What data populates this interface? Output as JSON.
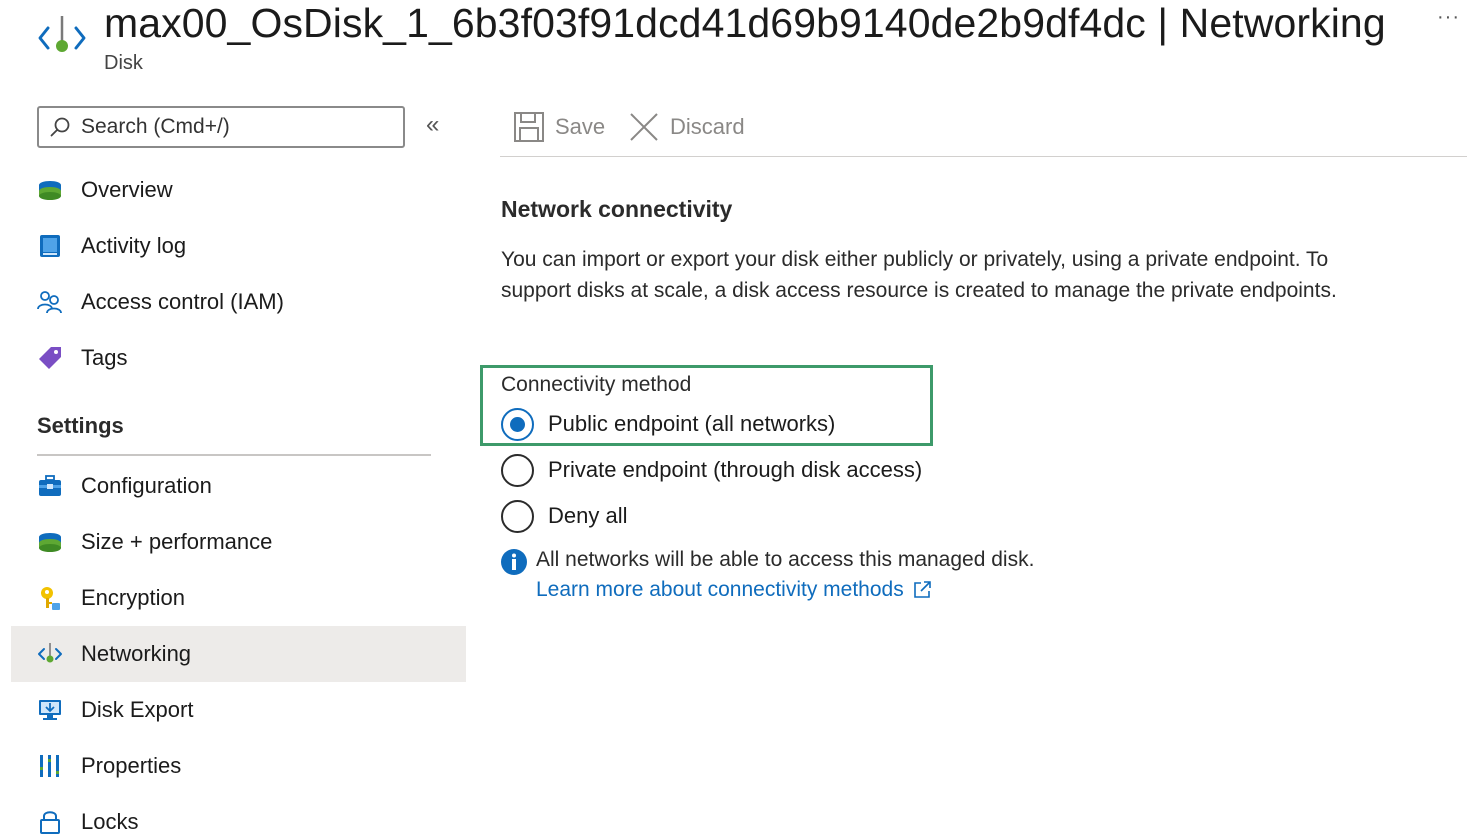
{
  "header": {
    "title": "max00_OsDisk_1_6b3f03f91dcd41d69b9140de2b9df4dc | Networking",
    "subtitle": "Disk",
    "more": "···"
  },
  "search": {
    "placeholder": "Search (Cmd+/)",
    "collapse": "«"
  },
  "sidebar": {
    "items": [
      {
        "label": "Overview",
        "icon": "overview-disk-icon"
      },
      {
        "label": "Activity log",
        "icon": "activity-log-icon"
      },
      {
        "label": "Access control (IAM)",
        "icon": "people-icon"
      },
      {
        "label": "Tags",
        "icon": "tag-icon"
      }
    ],
    "settings_header": "Settings",
    "settings_items": [
      {
        "label": "Configuration",
        "icon": "toolbox-icon"
      },
      {
        "label": "Size + performance",
        "icon": "disk-stack-icon"
      },
      {
        "label": "Encryption",
        "icon": "key-icon"
      },
      {
        "label": "Networking",
        "icon": "networking-icon",
        "active": true
      },
      {
        "label": "Disk Export",
        "icon": "disk-export-icon"
      },
      {
        "label": "Properties",
        "icon": "properties-icon"
      },
      {
        "label": "Locks",
        "icon": "lock-icon"
      }
    ]
  },
  "toolbar": {
    "save_label": "Save",
    "discard_label": "Discard"
  },
  "main": {
    "section_title": "Network connectivity",
    "description": "You can import or export your disk either publicly or privately, using a private endpoint. To support disks at scale, a disk access resource is created to manage the private endpoints.",
    "connectivity_label": "Connectivity method",
    "options": [
      {
        "label": "Public endpoint (all networks)",
        "selected": true
      },
      {
        "label": "Private endpoint (through disk access)",
        "selected": false
      },
      {
        "label": "Deny all",
        "selected": false
      }
    ],
    "info_text": "All networks will be able to access this managed disk.",
    "learn_more": "Learn more about connectivity methods"
  },
  "colors": {
    "accent": "#0f6cbd",
    "highlight_box": "#3d9a6a",
    "active_nav": "#edebe9"
  }
}
